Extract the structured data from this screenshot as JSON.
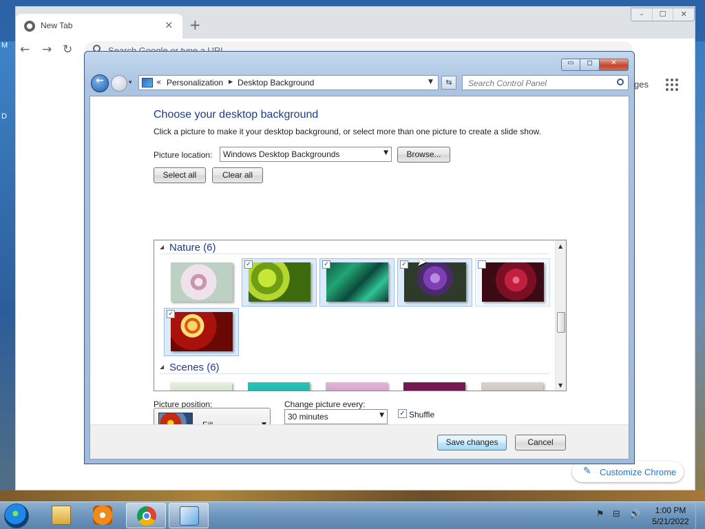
{
  "desktop": {
    "left_letters": [
      "M",
      "D"
    ]
  },
  "chrome": {
    "tab_title": "New Tab",
    "tab_close": "×",
    "new_tab": "+",
    "window_buttons": [
      "–",
      "☐",
      "✕"
    ],
    "back": "←",
    "forward": "→",
    "reload": "↻",
    "omnibox_placeholder": "Search Google or type a URL",
    "side_text": "ges",
    "customize_label": "Customize Chrome",
    "customize_icon": "pencil-icon"
  },
  "control_panel": {
    "caption_buttons": [
      "▭",
      "◻",
      "✕"
    ],
    "back_glyph": "←",
    "history_glyph": "▾",
    "address_chevrons": "«",
    "breadcrumbs": [
      "Personalization",
      "Desktop Background"
    ],
    "breadcrumb_sep": "▶",
    "address_drop": "▼",
    "refresh_glyph": "⇆",
    "search_placeholder": "Search Control Panel",
    "heading": "Choose your desktop background",
    "description": "Click a picture to make it your desktop background, or select more than one picture to create a slide show.",
    "picture_location_label": "Picture location:",
    "picture_location_value": "Windows Desktop Backgrounds",
    "browse_button": "Browse...",
    "select_all_button": "Select all",
    "clear_all_button": "Clear all",
    "groups": [
      {
        "label": "Nature (6)",
        "thumbnails": [
          {
            "name": "pink-dandelion",
            "checked": false,
            "selected": false,
            "show_check": false
          },
          {
            "name": "green-bubbles",
            "checked": true,
            "selected": true,
            "show_check": true
          },
          {
            "name": "green-leaves",
            "checked": true,
            "selected": true,
            "show_check": true
          },
          {
            "name": "purple-thistle",
            "checked": true,
            "selected": true,
            "show_check": true
          },
          {
            "name": "red-dahlia",
            "checked": false,
            "selected": false,
            "show_check": true
          },
          {
            "name": "red-yellow-petals",
            "checked": true,
            "selected": true,
            "show_check": true
          }
        ]
      },
      {
        "label": "Scenes (6)",
        "thumbnails": []
      }
    ],
    "check_glyph": "✓",
    "picture_position_label": "Picture position:",
    "picture_position_value": "Fill",
    "change_every_label": "Change picture every:",
    "change_every_value": "30 minutes",
    "shuffle_label": "Shuffle",
    "shuffle_checked": true,
    "save_button": "Save changes",
    "cancel_button": "Cancel",
    "combo_arrow": "▼",
    "scroll_up": "▲",
    "scroll_down": "▼",
    "group_expanded_glyph": "◢"
  },
  "taskbar": {
    "tray_icons": [
      "flag-error-icon",
      "network-icon",
      "volume-icon"
    ],
    "time": "1:00 PM",
    "date": "5/21/2022"
  }
}
